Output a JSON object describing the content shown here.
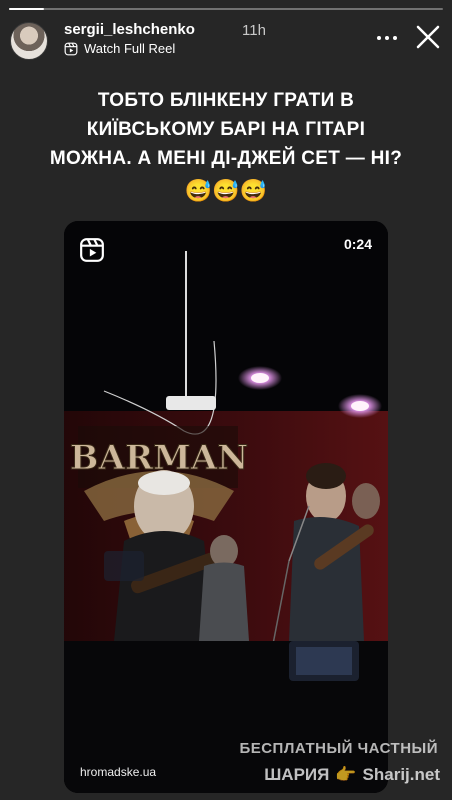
{
  "story": {
    "progress": 0.08
  },
  "header": {
    "username": "sergii_leshchenko",
    "time": "11h",
    "reel_link": "Watch Full Reel"
  },
  "caption": {
    "line1": "ТОБТО БЛІНКЕНУ ГРАТИ В",
    "line2": "КИЇВСЬКОМУ БАРІ НА ГІТАРІ",
    "line3": "МОЖНА. А МЕНІ ДІ-ДЖЕЙ СЕТ — НІ?",
    "emojis": "😅😅😅"
  },
  "reel": {
    "duration": "0:24",
    "sign_text": "BARMAN",
    "source": "hromadske.ua"
  },
  "watermark": {
    "line1": "БЕСПЛАТНЫЙ ЧАСТНЫЙ",
    "line2_a": "ШАРИЯ",
    "line2_hand": "👉",
    "line2_b": "Sharij.net"
  },
  "colors": {
    "background": "#262626",
    "text": "#ffffff"
  },
  "icons": [
    "reel-icon",
    "more-icon",
    "close-icon",
    "reels-badge-icon"
  ]
}
